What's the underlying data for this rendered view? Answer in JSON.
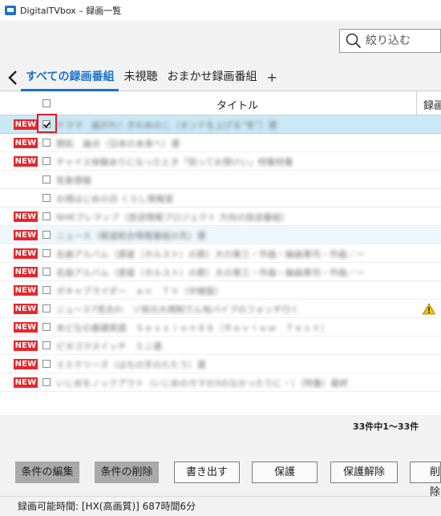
{
  "window": {
    "title": "DigitalTVbox – 録画一覧"
  },
  "search": {
    "placeholder": "絞り込む"
  },
  "tabs": [
    {
      "label": "すべての録画番組",
      "active": true
    },
    {
      "label": "未視聴",
      "active": false
    },
    {
      "label": "おまかせ録画番組",
      "active": false
    }
  ],
  "tab_add_label": "+",
  "table": {
    "headers": {
      "title": "タイトル",
      "recorded": "録画"
    },
    "badge_label": "NEW",
    "rows": [
      {
        "new": true,
        "checked": true,
        "title": "ドラマ　曲がれ！きれめのこ（オンナを上げる“気”）選"
      },
      {
        "new": true,
        "checked": false,
        "title": "開拓　論点（日本の未来へ）選"
      },
      {
        "new": true,
        "checked": false,
        "title": "チャイス体験ありになったとき「知ってお得けい」特集特番"
      },
      {
        "new": false,
        "checked": false,
        "title": "気象情報"
      },
      {
        "new": false,
        "checked": false,
        "title": "お得はじめの日 くらし情報室"
      },
      {
        "new": true,
        "checked": false,
        "title": "NHKプレマップ（放送情報プロジェクト 方向の放送番組）"
      },
      {
        "new": true,
        "checked": false,
        "title": "ニュース（報道統合情報番組の先）選"
      },
      {
        "new": true,
        "checked": false,
        "title": "名曲アルバム（惑星（ホルスト）の歌）大の東三・作曲・編曲東司・作曲／ー"
      },
      {
        "new": true,
        "checked": false,
        "title": "名曲アルバム（惑星（ホルスト）の歌）大の東三・作曲・編曲東司・作曲／ー"
      },
      {
        "new": true,
        "checked": false,
        "title": "ボキャブライダー　ａｎ　ＴＶ（中継版）"
      },
      {
        "new": true,
        "checked": false,
        "title": "ニュース7見合わ　ソ地元大規制でん地パイプのフォッチ行く",
        "warning": true
      },
      {
        "new": true,
        "checked": false,
        "title": "あどなの基礎英語　Ｓｅｓｓｉｏｎ８８（Ｒｅｖｉｅｗ　Ｔｅｓｔ）"
      },
      {
        "new": true,
        "checked": false,
        "title": "ピタゴラスイッチ　ミニ選"
      },
      {
        "new": true,
        "checked": false,
        "title": "ミミクリーズ（はちの手のたたう）選"
      },
      {
        "new": true,
        "checked": false,
        "title": "いじめをノックアウト（いじめのカマの3のなかったりに・）（特番）最終"
      }
    ]
  },
  "count_text": "33件中1～33件",
  "buttons": [
    {
      "label": "条件の編集",
      "disabled": true
    },
    {
      "label": "条件の削除",
      "disabled": true
    },
    {
      "label": "書き出す",
      "disabled": false
    },
    {
      "label": "保護",
      "disabled": false
    },
    {
      "label": "保護解除",
      "disabled": false
    },
    {
      "label": "削除",
      "disabled": false
    }
  ],
  "status": {
    "text": "録画可能時間: [HX(高画質)] 687時間6分"
  },
  "colors": {
    "accent": "#1a73c9",
    "new_badge": "#e8262a",
    "selected_row": "#cbe8f6",
    "highlight_box": "#e11c23"
  },
  "icons": {
    "app": "app-icon",
    "search": "search-icon",
    "back": "chevron-left-icon",
    "warning": "warning-icon"
  }
}
